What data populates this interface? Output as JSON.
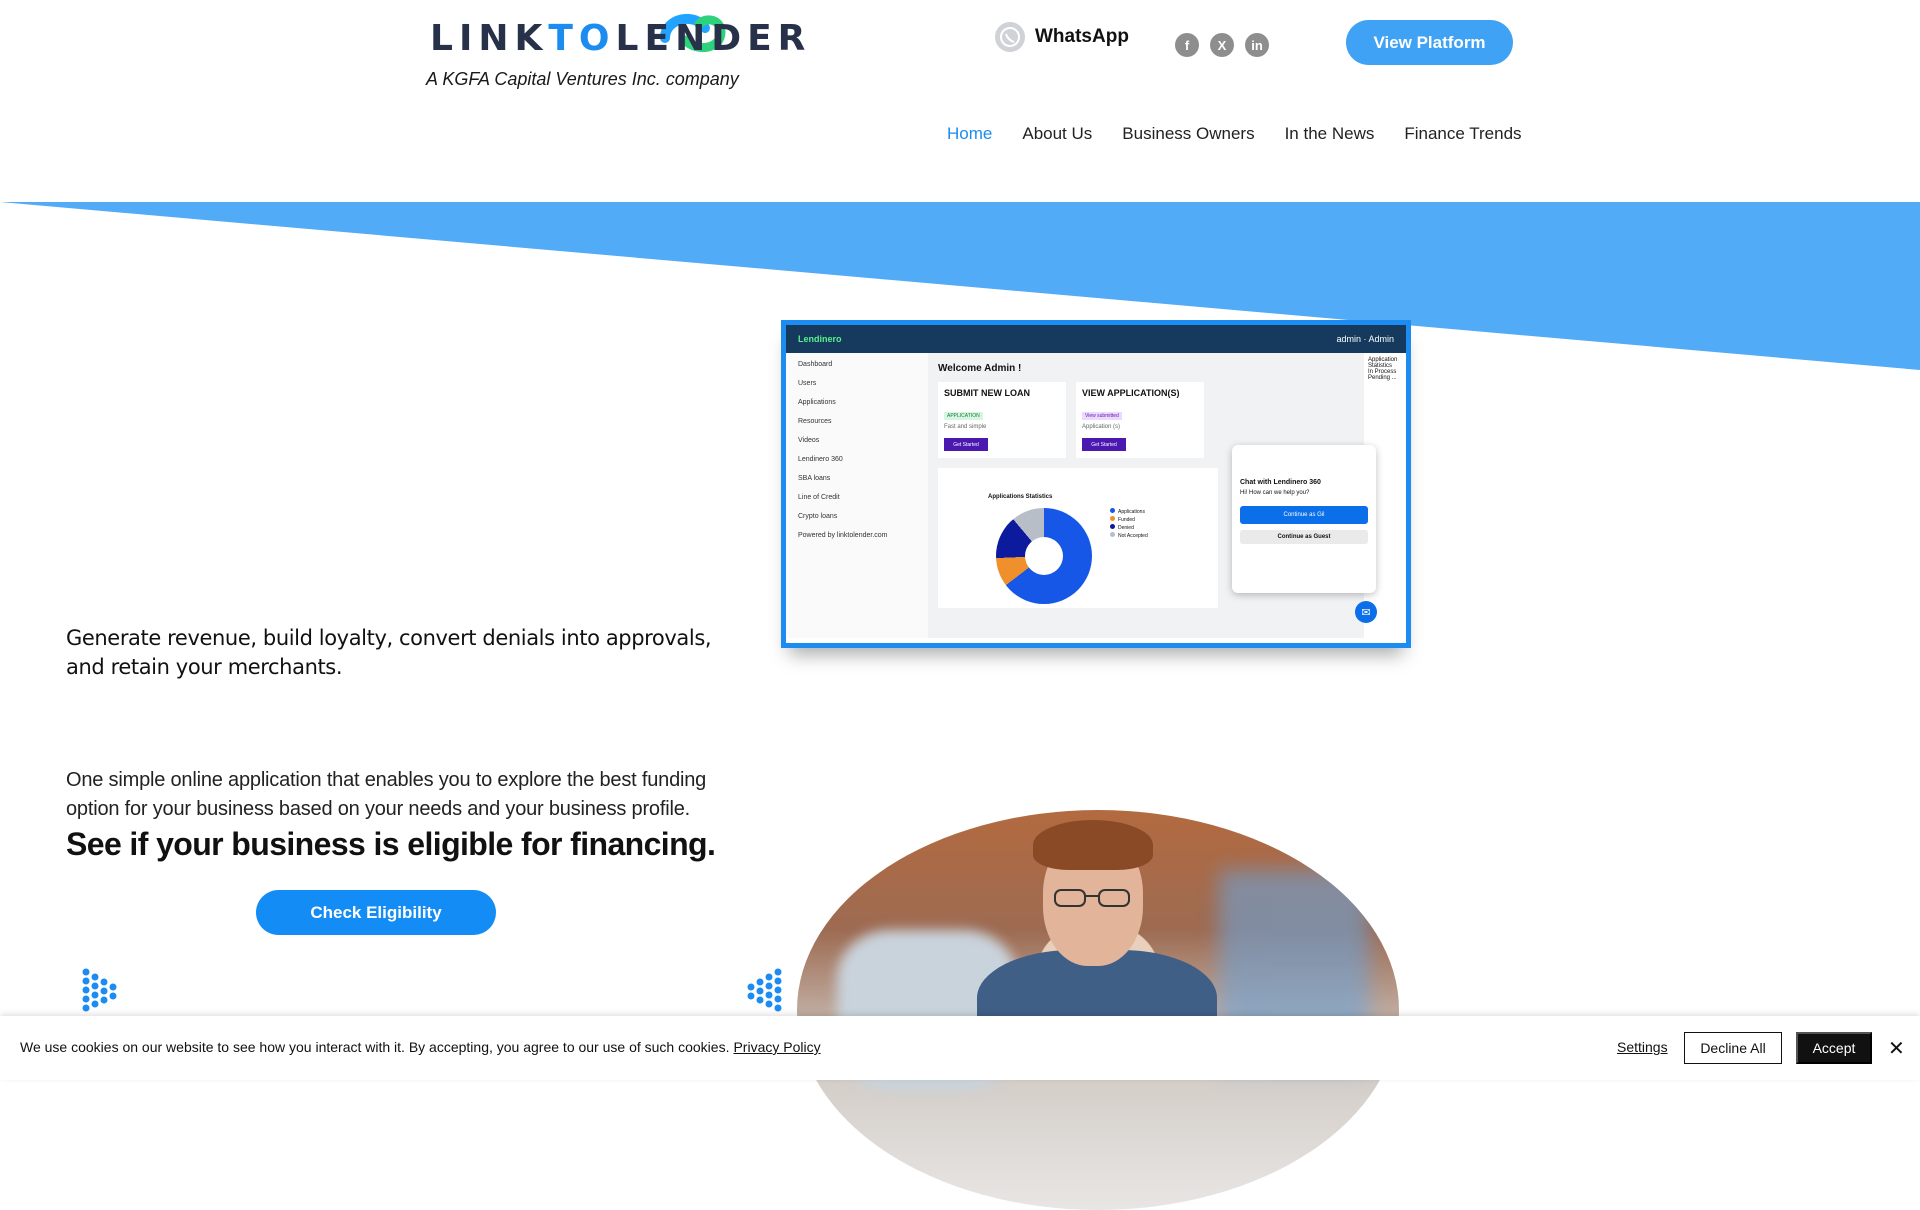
{
  "header": {
    "logo_link": "LINK",
    "logo_to": "TO",
    "logo_lender": "LENDER",
    "tagline": "A KGFA Capital Ventures Inc. company",
    "whatsapp_label": "WhatsApp",
    "social": [
      {
        "icon": "facebook-icon",
        "glyph": "f"
      },
      {
        "icon": "x-twitter-icon",
        "glyph": "X"
      },
      {
        "icon": "linkedin-icon",
        "glyph": "in"
      }
    ],
    "platform_button": "View Platform"
  },
  "nav": {
    "items": [
      "Home",
      "About Us",
      "Business Owners",
      "In the News",
      "Finance Trends"
    ],
    "active": "Home"
  },
  "dashboard": {
    "brand": "Lendinero",
    "user": "admin",
    "user_role": "Admin",
    "sidebar": [
      "Dashboard",
      "Users",
      "Applications",
      "Resources",
      "Videos",
      "Lendinero 360",
      "SBA loans",
      "Line of Credit",
      "Crypto loans"
    ],
    "powered_by": "Powered by linktolender.com",
    "welcome": "Welcome Admin !",
    "card1_title": "SUBMIT NEW LOAN",
    "card1_tag": "APPLICATION",
    "card1_sub": "Fast and simple",
    "card1_btn": "Get Started",
    "card2_title": "VIEW APPLICATION(S)",
    "card2_tag": "View submitted",
    "card2_sub": "Application (s)",
    "card2_btn": "Get Started",
    "stats_title": "Applications Statistics",
    "legend": [
      "Applications",
      "Funded",
      "Denied",
      "Not Accepted"
    ],
    "side_stats_title": "Application Statistics",
    "side_in_process": "In Process",
    "side_pending": "Pending ...",
    "chat_title": "Chat with Lendinero 360",
    "chat_prompt": "Hi! How can we help you?",
    "chat_btn1": "Continue as Gil",
    "chat_btn2": "Continue as Guest"
  },
  "hero": {
    "lead": "Generate revenue, build loyalty, convert denials into approvals, and retain your merchants.",
    "paragraph": "One simple online application that enables you to explore the best funding option for your business based on your needs and your business profile.",
    "eligible": "See if your business is eligible for financing.",
    "check_button": "Check Eligibility"
  },
  "cookie": {
    "message": "We use cookies on our website to see how you interact with it. By accepting, you agree to our use of such cookies.",
    "privacy_link": "Privacy Policy",
    "settings": "Settings",
    "decline": "Decline All",
    "accept": "Accept"
  },
  "colors": {
    "accent": "#1c8cf0",
    "banner": "#52abf7",
    "button": "#3fa2f5"
  }
}
